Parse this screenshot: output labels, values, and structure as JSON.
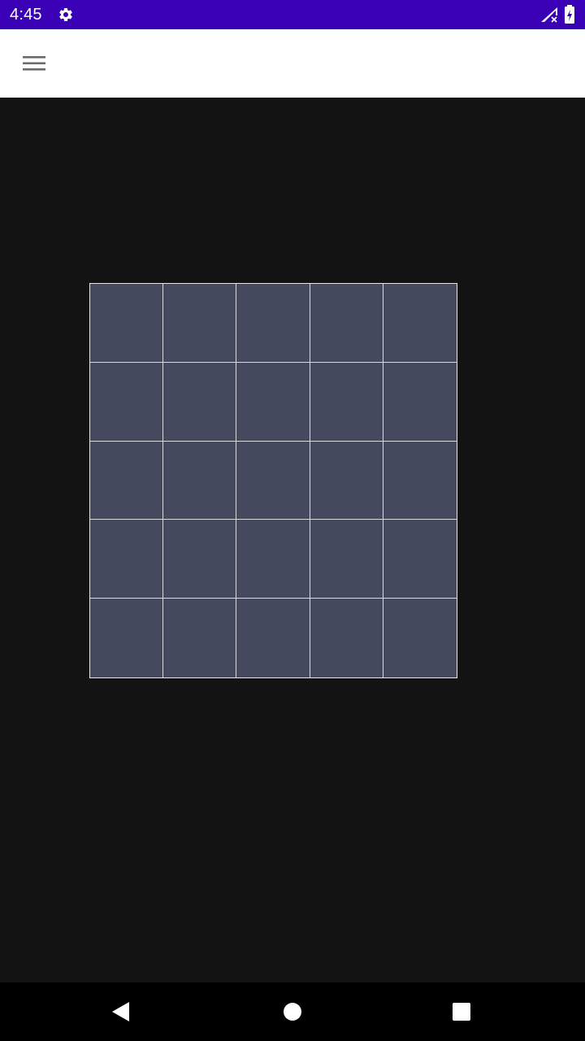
{
  "status_bar": {
    "time": "4:45",
    "background": "#3a00b6",
    "icons": [
      "gear-icon",
      "signal-off-icon",
      "battery-charging-icon"
    ]
  },
  "app_bar": {
    "menu_icon": "hamburger-menu-icon",
    "background": "#ffffff"
  },
  "board": {
    "rows": 5,
    "columns": 5,
    "cell_color": "#454a5e",
    "line_color": "#d8d9e0"
  },
  "nav_bar": {
    "icons": [
      "back-icon",
      "home-icon",
      "recents-icon"
    ]
  }
}
